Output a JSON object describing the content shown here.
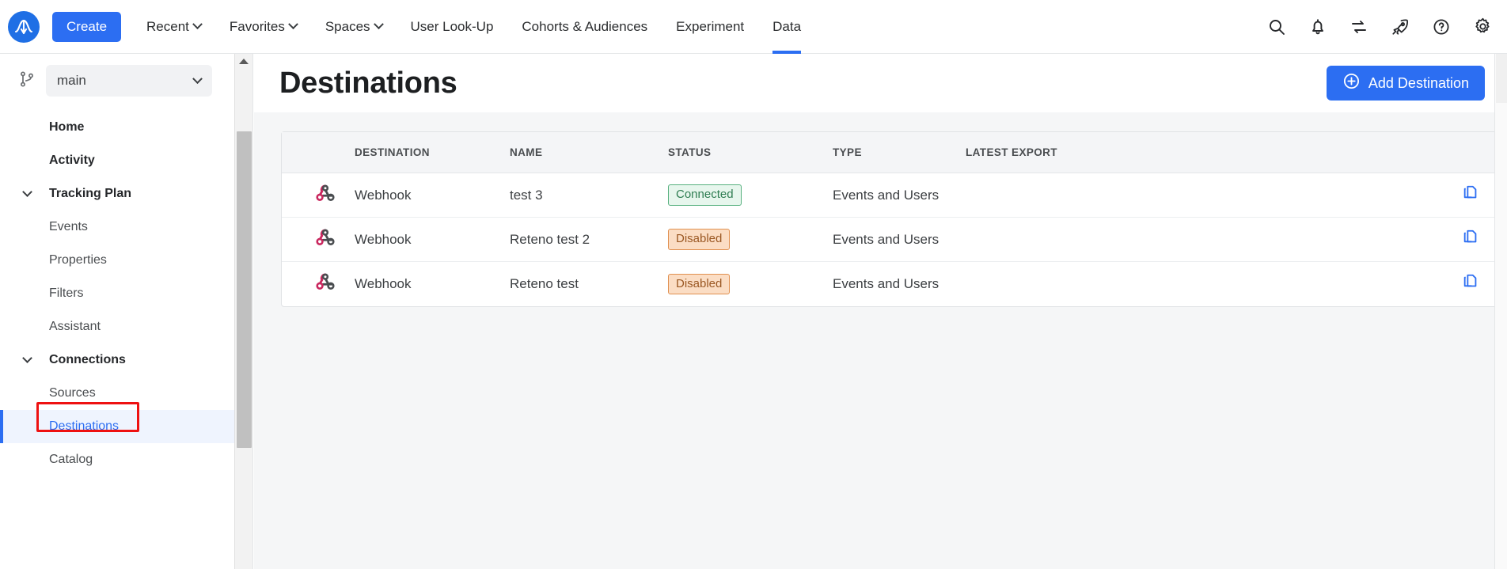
{
  "topnav": {
    "logo_name": "amplitude-logo",
    "create_label": "Create",
    "items": [
      {
        "label": "Recent",
        "has_caret": true,
        "active": false
      },
      {
        "label": "Favorites",
        "has_caret": true,
        "active": false
      },
      {
        "label": "Spaces",
        "has_caret": true,
        "active": false
      },
      {
        "label": "User Look-Up",
        "has_caret": false,
        "active": false
      },
      {
        "label": "Cohorts & Audiences",
        "has_caret": false,
        "active": false
      },
      {
        "label": "Experiment",
        "has_caret": false,
        "active": false
      },
      {
        "label": "Data",
        "has_caret": false,
        "active": true
      }
    ],
    "icons": [
      "search-icon",
      "bell-icon",
      "transfer-icon",
      "rocket-icon",
      "help-icon",
      "gear-icon"
    ],
    "active_accent": "#2c6ef2"
  },
  "sidebar": {
    "branch": {
      "icon": "git-branch-icon",
      "value": "main"
    },
    "items": [
      {
        "label": "Home",
        "bold": true,
        "chevron": false,
        "selected": false
      },
      {
        "label": "Activity",
        "bold": true,
        "chevron": false,
        "selected": false
      },
      {
        "label": "Tracking Plan",
        "bold": true,
        "chevron": true,
        "selected": false
      },
      {
        "label": "Events",
        "bold": false,
        "chevron": false,
        "selected": false
      },
      {
        "label": "Properties",
        "bold": false,
        "chevron": false,
        "selected": false
      },
      {
        "label": "Filters",
        "bold": false,
        "chevron": false,
        "selected": false
      },
      {
        "label": "Assistant",
        "bold": false,
        "chevron": false,
        "selected": false
      },
      {
        "label": "Connections",
        "bold": true,
        "chevron": true,
        "selected": false
      },
      {
        "label": "Sources",
        "bold": false,
        "chevron": false,
        "selected": false
      },
      {
        "label": "Destinations",
        "bold": false,
        "chevron": false,
        "selected": true
      },
      {
        "label": "Catalog",
        "bold": false,
        "chevron": false,
        "selected": false
      }
    ],
    "highlight_color": "#ee1111",
    "selected_color": "#2c6ef2"
  },
  "main": {
    "title": "Destinations",
    "add_button_label": "Add Destination",
    "table": {
      "columns": [
        "DESTINATION",
        "NAME",
        "STATUS",
        "TYPE",
        "LATEST EXPORT"
      ],
      "rows": [
        {
          "icon": "webhook-icon",
          "destination": "Webhook",
          "name": "test 3",
          "status": "Connected",
          "status_kind": "connected",
          "type": "Events and Users",
          "latest_export": "",
          "action": "copy-icon"
        },
        {
          "icon": "webhook-icon",
          "destination": "Webhook",
          "name": "Reteno test 2",
          "status": "Disabled",
          "status_kind": "disabled",
          "type": "Events and Users",
          "latest_export": "",
          "action": "copy-icon"
        },
        {
          "icon": "webhook-icon",
          "destination": "Webhook",
          "name": "Reteno test",
          "status": "Disabled",
          "status_kind": "disabled",
          "type": "Events and Users",
          "latest_export": "",
          "action": "copy-icon"
        }
      ]
    },
    "status_colors": {
      "connected_text": "#2f7d52",
      "connected_bg": "#e7f6ed",
      "disabled_text": "#9a5722",
      "disabled_bg": "#fbddc4"
    }
  }
}
